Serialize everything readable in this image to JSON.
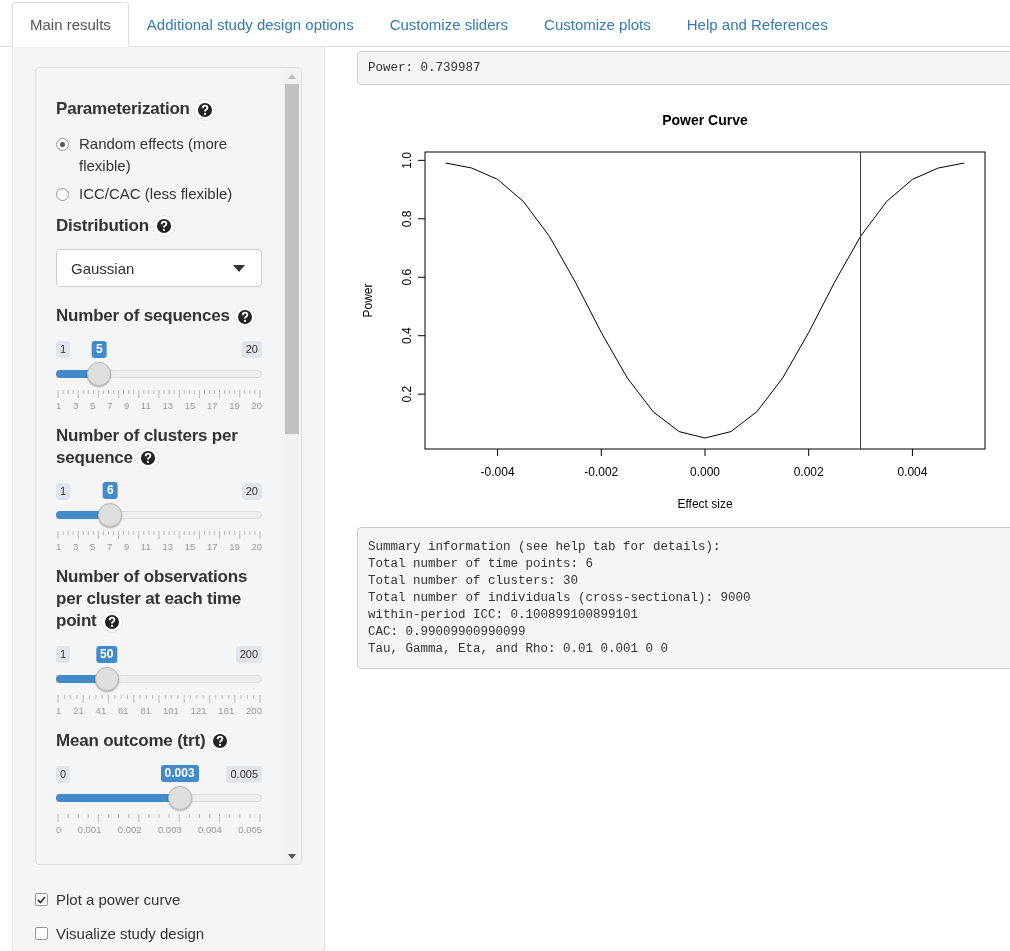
{
  "tabs": [
    {
      "label": "Main results",
      "selected": true
    },
    {
      "label": "Additional study design options",
      "selected": false
    },
    {
      "label": "Customize sliders",
      "selected": false
    },
    {
      "label": "Customize plots",
      "selected": false
    },
    {
      "label": "Help and References",
      "selected": false
    }
  ],
  "sidebar": {
    "controls": [
      {
        "kind": "radio",
        "label": "Parameterization",
        "options": [
          {
            "label": "Random effects (more flexible)",
            "selected": true
          },
          {
            "label": "ICC/CAC (less flexible)",
            "selected": false
          }
        ]
      },
      {
        "kind": "select",
        "label": "Distribution",
        "value": "Gaussian"
      },
      {
        "kind": "slider",
        "label": "Number of sequences",
        "min": "1",
        "max": "20",
        "value": "5",
        "level": 0.2105,
        "ticks": [
          "1",
          "3",
          "5",
          "7",
          "9",
          "11",
          "13",
          "15",
          "17",
          "19",
          "20"
        ]
      },
      {
        "kind": "slider",
        "label": "Number of clusters per sequence",
        "min": "1",
        "max": "20",
        "value": "6",
        "level": 0.2632,
        "ticks": [
          "1",
          "3",
          "5",
          "7",
          "9",
          "11",
          "13",
          "15",
          "17",
          "19",
          "20"
        ]
      },
      {
        "kind": "slider",
        "label": "Number of observations per cluster at each time point",
        "min": "1",
        "max": "200",
        "value": "50",
        "level": 0.2462,
        "ticks": [
          "1",
          "21",
          "41",
          "61",
          "81",
          "101",
          "121",
          "161",
          "200"
        ]
      },
      {
        "kind": "slider",
        "label": "Mean outcome (trt)",
        "min": "0",
        "max": "0.005",
        "value": "0.003",
        "level": 0.6,
        "ticks": [
          "0",
          "0.001",
          "0.002",
          "0.003",
          "0.004",
          "0.005"
        ]
      }
    ],
    "checkboxes": [
      {
        "label": "Plot a power curve",
        "checked": true
      },
      {
        "label": "Visualize study design",
        "checked": false
      }
    ]
  },
  "main": {
    "power_output": "Power: 0.739987",
    "chart_data": {
      "type": "line",
      "title": "Power Curve",
      "xlabel": "Effect size",
      "ylabel": "Power",
      "x": [
        -0.005,
        -0.0045,
        -0.004,
        -0.0035,
        -0.003,
        -0.0025,
        -0.002,
        -0.0015,
        -0.001,
        -0.0005,
        0,
        0.0005,
        0.001,
        0.0015,
        0.002,
        0.0025,
        0.003,
        0.0035,
        0.004,
        0.0045,
        0.005
      ],
      "series": [
        {
          "color": "#000000",
          "values": [
            0.991,
            0.974,
            0.935,
            0.859,
            0.74,
            0.583,
            0.411,
            0.256,
            0.14,
            0.072,
            0.05,
            0.072,
            0.14,
            0.256,
            0.411,
            0.583,
            0.74,
            0.859,
            0.935,
            0.974,
            0.991
          ]
        }
      ],
      "xlim": [
        -0.0054,
        0.0054
      ],
      "ylim": [
        0.0124,
        1.0286
      ],
      "xticks": [
        {
          "value": -0.004,
          "label": "-0.004"
        },
        {
          "value": -0.002,
          "label": "-0.002"
        },
        {
          "value": 0,
          "label": "0.000"
        },
        {
          "value": 0.002,
          "label": "0.002"
        },
        {
          "value": 0.004,
          "label": "0.004"
        }
      ],
      "yticks": [
        {
          "value": 0.2,
          "label": "0.2"
        },
        {
          "value": 0.4,
          "label": "0.4"
        },
        {
          "value": 0.6,
          "label": "0.6"
        },
        {
          "value": 0.8,
          "label": "0.8"
        },
        {
          "value": 1,
          "label": "1.0"
        }
      ],
      "ref_lines": [
        {
          "axis": "x",
          "value": 0.003
        }
      ]
    },
    "summary": [
      "Summary information (see help tab for details):",
      "Total number of time points: 6",
      "Total number of clusters: 30",
      "Total number of individuals (cross-sectional): 9000",
      "within-period ICC: 0.100899100899101",
      "CAC: 0.99009900990099",
      "Tau, Gamma, Eta, and Rho: 0.01 0.001 0 0"
    ]
  }
}
